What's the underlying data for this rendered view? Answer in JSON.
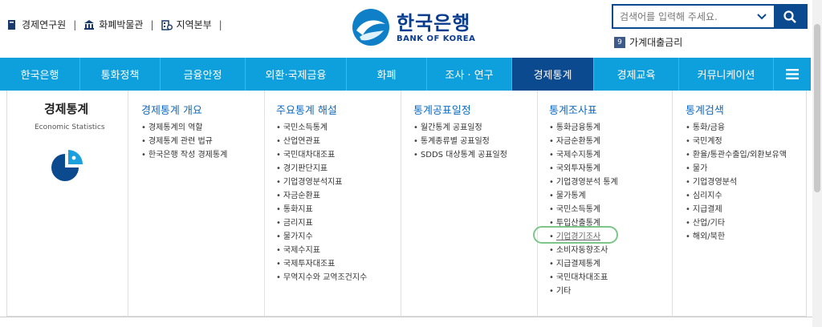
{
  "quick_links": [
    {
      "label": "경제연구원",
      "icon": "book-icon"
    },
    {
      "label": "화폐박물관",
      "icon": "museum-icon"
    },
    {
      "label": "지역본부",
      "icon": "building-icon"
    }
  ],
  "separator": "|",
  "logo": {
    "korean": "한국은행",
    "english": "BANK OF KOREA"
  },
  "search": {
    "placeholder": "검색어를 입력해 주세요.",
    "dropdown_icon": "chevron-down-icon",
    "button_icon": "search-icon"
  },
  "featured_link": {
    "number": "9",
    "label": "가계대출금리"
  },
  "nav": {
    "items": [
      {
        "label": "한국은행",
        "width": 100
      },
      {
        "label": "통화정책",
        "width": 100
      },
      {
        "label": "금융안정",
        "width": 106
      },
      {
        "label": "외환·국제금융",
        "width": 126
      },
      {
        "label": "화폐",
        "width": 100
      },
      {
        "label": "조사 · 연구",
        "width": 106
      },
      {
        "label": "경제통계",
        "width": 102,
        "active": true
      },
      {
        "label": "경제교육",
        "width": 106
      },
      {
        "label": "커뮤니케이션",
        "width": 118
      }
    ],
    "menu_icon": "hamburger-icon"
  },
  "mega_menu": {
    "intro": {
      "title": "경제통계",
      "subtitle": "Economic Statistics",
      "icon": "pie-chart-icon"
    },
    "columns": [
      {
        "title": "경제통계 개요",
        "items": [
          "경제통계의 역할",
          "경제통계 관련 법규",
          "한국은행 작성 경제통계"
        ]
      },
      {
        "title": "주요통계 해설",
        "items": [
          "국민소득통계",
          "산업연관표",
          "국민대차대조표",
          "경기판단지표",
          "기업경영분석지표",
          "자금순환표",
          "통화지표",
          "금리지표",
          "물가지수",
          "국제수지표",
          "국제투자대조표",
          "무역지수와 교역조건지수"
        ]
      },
      {
        "title": "통계공표일정",
        "items": [
          "월간통계 공표일정",
          "통계종류별 공표일정",
          "SDDS 대상통계 공표일정"
        ]
      },
      {
        "title": "통계조사표",
        "items": [
          "통화금융통계",
          "자금순환통계",
          "국제수지통계",
          "국외투자통계",
          "기업경영분석 통계",
          "물가통계",
          "국민소득통계",
          "투입산출통계",
          "기업경기조사",
          "소비자동향조사",
          "지급결제통계",
          "국민대차대조표",
          "기타"
        ],
        "highlighted_index": 8
      },
      {
        "title": "통계검색",
        "items": [
          "통화/금융",
          "국민계정",
          "환율/통관수출입/외환보유액",
          "물가",
          "기업경영분석",
          "심리지수",
          "지급결제",
          "산업/기타",
          "해외/북한"
        ]
      }
    ]
  },
  "colors": {
    "nav_bg": "#0ea0dd",
    "nav_active": "#0b4a8f",
    "highlight": "#7cc68a",
    "title_blue": "#0b6ac2"
  }
}
